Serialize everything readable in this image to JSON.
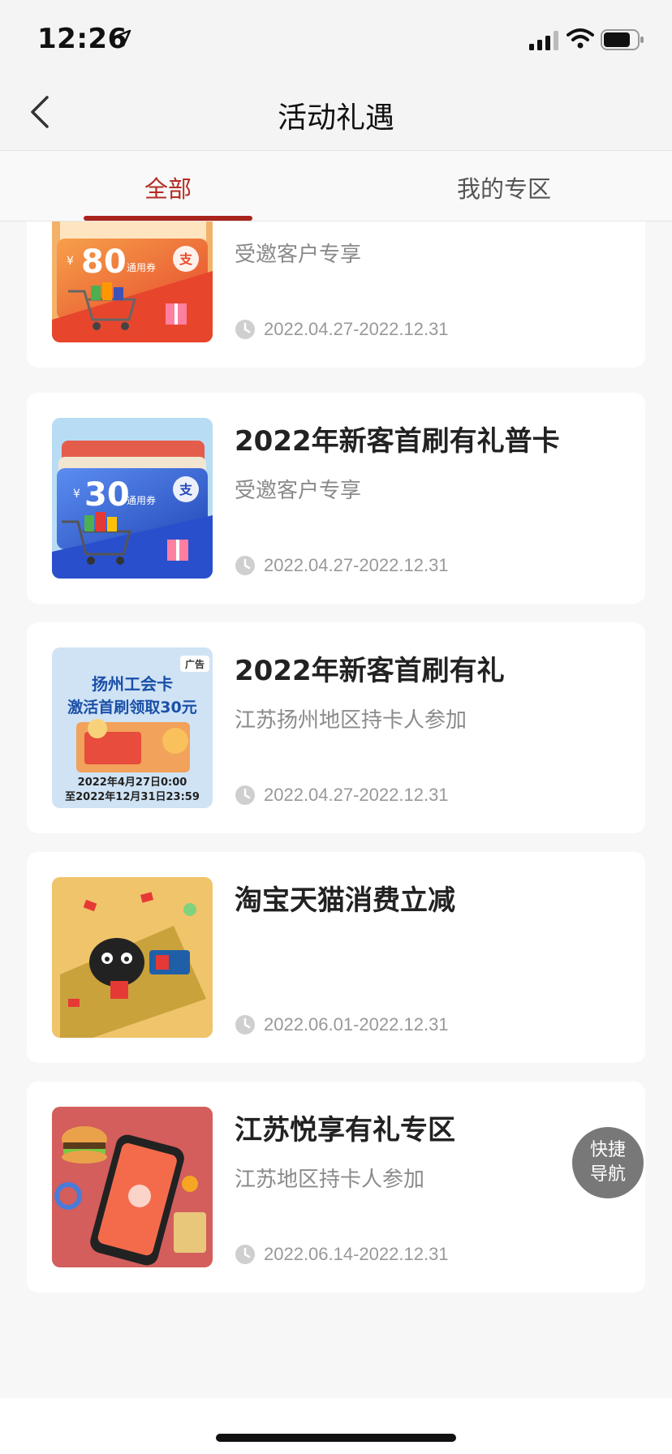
{
  "status": {
    "time": "12:26"
  },
  "nav": {
    "title": "活动礼遇"
  },
  "tabs": [
    {
      "label": "全部"
    },
    {
      "label": "我的专区"
    }
  ],
  "cards": [
    {
      "title": "",
      "subtitle": "受邀客户专享",
      "date": "2022.04.27-2022.12.31",
      "thumb": {
        "amount": "80",
        "caption": "通用券",
        "currency": "¥",
        "badge": "支"
      }
    },
    {
      "title": "2022年新客首刷有礼普卡",
      "subtitle": "受邀客户专享",
      "date": "2022.04.27-2022.12.31",
      "thumb": {
        "amount": "30",
        "caption": "通用券",
        "currency": "¥",
        "badge": "支"
      }
    },
    {
      "title": "2022年新客首刷有礼",
      "subtitle": "江苏扬州地区持卡人参加",
      "date": "2022.04.27-2022.12.31",
      "thumb": {
        "ad_tag": "广告",
        "line1": "扬州工会卡",
        "line2": "激活首刷领取30元",
        "line3": "2022年4月27日0:00",
        "line4": "至2022年12月31日23:59"
      }
    },
    {
      "title": "淘宝天猫消费立减",
      "subtitle": "",
      "date": "2022.06.01-2022.12.31",
      "thumb": {}
    },
    {
      "title": "江苏悦享有礼专区",
      "subtitle": "江苏地区持卡人参加",
      "date": "2022.06.14-2022.12.31",
      "thumb": {}
    }
  ],
  "fab": {
    "line1": "快捷",
    "line2": "导航"
  }
}
